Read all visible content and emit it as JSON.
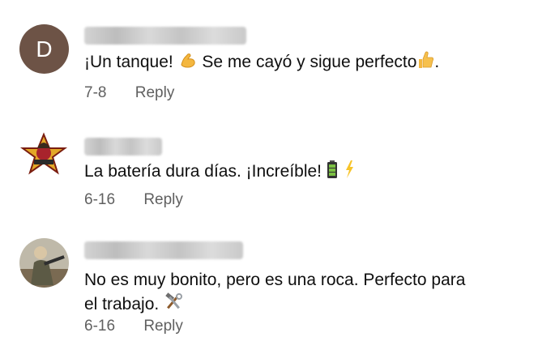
{
  "comments": [
    {
      "avatar_letter": "D",
      "text": "¡Un tanque! ",
      "text_after": " Se me cayó y sigue perfecto",
      "text_end": ".",
      "date": "7-8",
      "reply_label": "Reply"
    },
    {
      "text": "La batería dura días. ¡Increíble! ",
      "date": "6-16",
      "reply_label": "Reply"
    },
    {
      "text_line1": "No es muy bonito, pero es una roca. Perfecto para",
      "text_line2": "el trabajo. ",
      "date": "6-16",
      "reply_label": "Reply"
    }
  ],
  "icons": {
    "c1_a": "flexed-biceps-icon",
    "c1_b": "thumbs-up-icon",
    "c2_a": "battery-icon",
    "c2_b": "lightning-icon",
    "c3_a": "hammer-and-wrench-icon"
  },
  "colors": {
    "avatar_d": "#6d5346",
    "meta": "#606060"
  }
}
